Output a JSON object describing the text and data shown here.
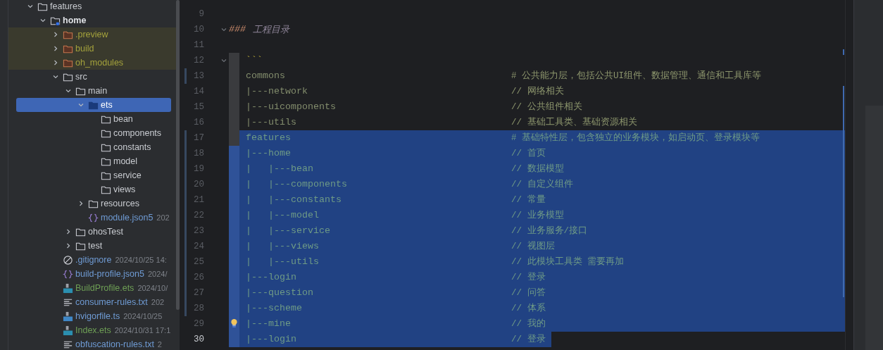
{
  "project_tree": [
    {
      "name": "features",
      "kind": "folder",
      "expanded": true,
      "selected": false,
      "color": "#c9ccd1",
      "children": [
        {
          "name": "home",
          "kind": "module",
          "expanded": true,
          "selected": false,
          "color": "#dfe1e5",
          "children": [
            {
              "name": ".preview",
              "kind": "excluded_folder",
              "expanded": false,
              "selected": false,
              "color": "#a4a23c"
            },
            {
              "name": "build",
              "kind": "excluded_folder",
              "expanded": false,
              "selected": false,
              "color": "#a4a23c"
            },
            {
              "name": "oh_modules",
              "kind": "excluded_folder",
              "expanded": false,
              "selected": false,
              "color": "#a4a23c"
            },
            {
              "name": "src",
              "kind": "folder",
              "expanded": true,
              "selected": false,
              "color": "#c9ccd1",
              "children": [
                {
                  "name": "main",
                  "kind": "folder",
                  "expanded": true,
                  "selected": false,
                  "color": "#c9ccd1",
                  "children": [
                    {
                      "name": "ets",
                      "kind": "source_folder",
                      "expanded": true,
                      "selected": true,
                      "children": [
                        {
                          "name": "bean",
                          "kind": "folder",
                          "selected": false,
                          "color": "#c9ccd1"
                        },
                        {
                          "name": "components",
                          "kind": "folder",
                          "selected": false,
                          "color": "#c9ccd1"
                        },
                        {
                          "name": "constants",
                          "kind": "folder",
                          "selected": false,
                          "color": "#c9ccd1"
                        },
                        {
                          "name": "model",
                          "kind": "folder",
                          "selected": false,
                          "color": "#c9ccd1"
                        },
                        {
                          "name": "service",
                          "kind": "folder",
                          "selected": false,
                          "color": "#c9ccd1"
                        },
                        {
                          "name": "views",
                          "kind": "folder",
                          "selected": false,
                          "color": "#c9ccd1"
                        }
                      ]
                    },
                    {
                      "name": "resources",
                      "kind": "folder",
                      "expanded": false,
                      "selected": false,
                      "color": "#c9ccd1"
                    },
                    {
                      "name": "module.json5",
                      "kind": "json",
                      "selected": false,
                      "color": "#6f9bd4",
                      "date": "202"
                    }
                  ]
                },
                {
                  "name": "ohosTest",
                  "kind": "folder",
                  "expanded": false,
                  "selected": false,
                  "color": "#c9ccd1"
                },
                {
                  "name": "test",
                  "kind": "folder",
                  "expanded": false,
                  "selected": false,
                  "color": "#c9ccd1"
                }
              ]
            },
            {
              "name": ".gitignore",
              "kind": "ignore",
              "selected": false,
              "color": "#6f9bd4",
              "date": "2024/10/25 14:"
            },
            {
              "name": "build-profile.json5",
              "kind": "json",
              "selected": false,
              "color": "#6f9bd4",
              "date": "2024/"
            },
            {
              "name": "BuildProfile.ets",
              "kind": "ets",
              "selected": false,
              "color": "#6e9f55",
              "date": "2024/10/"
            },
            {
              "name": "consumer-rules.txt",
              "kind": "txt",
              "selected": false,
              "color": "#6f9bd4",
              "date": "202"
            },
            {
              "name": "hvigorfile.ts",
              "kind": "ts",
              "selected": false,
              "color": "#6f9bd4",
              "date": "2024/10/25"
            },
            {
              "name": "Index.ets",
              "kind": "ets",
              "selected": false,
              "color": "#6e9f55",
              "date": "2024/10/31 17:1"
            },
            {
              "name": "obfuscation-rules.txt",
              "kind": "txt",
              "selected": false,
              "color": "#6f9bd4",
              "date": "2"
            }
          ]
        }
      ]
    }
  ],
  "editor": {
    "lines": [
      {
        "number": "9",
        "kind": "blank",
        "selected": false,
        "current": false,
        "changed": false
      },
      {
        "number": "10",
        "kind": "heading",
        "marker": "###",
        "code": "工程目录",
        "foldable": true,
        "selected": false,
        "current": false,
        "changed": false
      },
      {
        "number": "11",
        "kind": "blank",
        "selected": false,
        "current": false,
        "changed": false
      },
      {
        "number": "12",
        "kind": "fence",
        "code": "```",
        "foldable": true,
        "selected": false,
        "current": false,
        "changed": false
      },
      {
        "number": "13",
        "kind": "code",
        "code": "commons",
        "comment": "# 公共能力层，包括公共UI组件、数据管理、通信和工具库等",
        "selected": false,
        "current": false,
        "changed": true
      },
      {
        "number": "14",
        "kind": "code",
        "code": "|---network",
        "comment": "// 网络相关",
        "selected": false,
        "current": false,
        "changed": false
      },
      {
        "number": "15",
        "kind": "code",
        "code": "|---uicomponents",
        "comment": "// 公共组件相关",
        "selected": false,
        "current": false,
        "changed": false
      },
      {
        "number": "16",
        "kind": "code",
        "code": "|---utils",
        "comment": "// 基础工具类、基础资源相关",
        "selected": false,
        "current": false,
        "changed": false
      },
      {
        "number": "17",
        "kind": "code",
        "code": "features",
        "comment": "# 基础特性层，包含独立的业务模块，如启动页、登录模块等",
        "selected": true,
        "current": false,
        "changed": true
      },
      {
        "number": "18",
        "kind": "code",
        "code": "|---home",
        "comment": "// 首页",
        "selected": true,
        "current": false,
        "changed": true
      },
      {
        "number": "19",
        "kind": "code",
        "code": "|   |---bean",
        "comment": "// 数据模型",
        "selected": true,
        "current": false,
        "changed": true
      },
      {
        "number": "20",
        "kind": "code",
        "code": "|   |---components",
        "comment": "// 自定义组件",
        "selected": true,
        "current": false,
        "changed": true
      },
      {
        "number": "21",
        "kind": "code",
        "code": "|   |---constants",
        "comment": "// 常量",
        "selected": true,
        "current": false,
        "changed": true
      },
      {
        "number": "22",
        "kind": "code",
        "code": "|   |---model",
        "comment": "// 业务模型",
        "selected": true,
        "current": false,
        "changed": true
      },
      {
        "number": "23",
        "kind": "code",
        "code": "|   |---service",
        "comment": "// 业务服务/接口",
        "selected": true,
        "current": false,
        "changed": true
      },
      {
        "number": "24",
        "kind": "code",
        "code": "|   |---views",
        "comment": "// 视图层",
        "selected": true,
        "current": false,
        "changed": true
      },
      {
        "number": "25",
        "kind": "code",
        "code": "|   |---utils",
        "comment": "// 此模块工具类 需要再加",
        "selected": true,
        "current": false,
        "changed": true
      },
      {
        "number": "26",
        "kind": "code",
        "code": "|---login",
        "comment": "// 登录",
        "selected": true,
        "current": false,
        "changed": true
      },
      {
        "number": "27",
        "kind": "code",
        "code": "|---question",
        "comment": "// 问答",
        "selected": true,
        "current": false,
        "changed": true
      },
      {
        "number": "28",
        "kind": "code",
        "code": "|---scheme",
        "comment": "// 体系",
        "selected": true,
        "current": false,
        "changed": true
      },
      {
        "number": "29",
        "kind": "code",
        "code": "|---mine",
        "comment": "// 我的",
        "selected": true,
        "current": false,
        "changed": false,
        "hint": true
      },
      {
        "number": "30",
        "kind": "code",
        "code": "|---login",
        "comment": "// 登录",
        "selected": true,
        "current": true,
        "changed": false
      }
    ]
  }
}
